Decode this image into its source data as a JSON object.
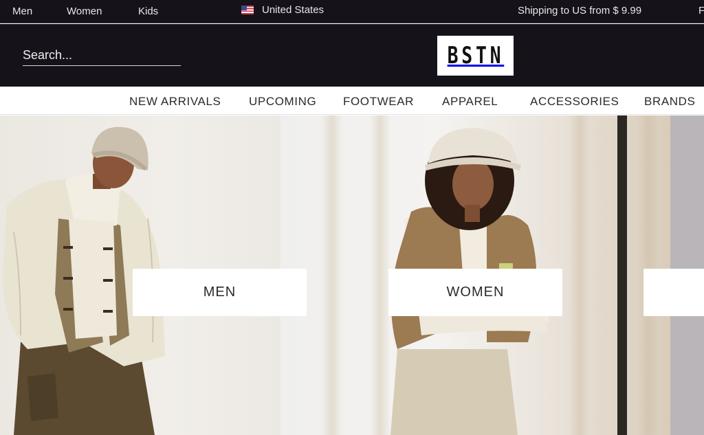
{
  "topbar": {
    "gender_links": [
      "Men",
      "Women",
      "Kids"
    ],
    "country": {
      "flag_icon": "us-flag-icon",
      "label": "United States"
    },
    "shipping": "Shipping to US from $ 9.99",
    "truncated_text": "F"
  },
  "header": {
    "search": {
      "placeholder": "Search...",
      "value": ""
    },
    "logo_text": "BSTN"
  },
  "nav": {
    "categories": [
      "NEW ARRIVALS",
      "UPCOMING",
      "FOOTWEAR",
      "APPAREL",
      "ACCESSORIES",
      "BRANDS"
    ]
  },
  "hero": {
    "cards": [
      "MEN",
      "WOMEN",
      ""
    ]
  },
  "colors": {
    "header_bg": "#16121a",
    "nav_bg": "#ffffff",
    "card_bg": "#ffffff",
    "text_dark": "#2a2a2a"
  }
}
